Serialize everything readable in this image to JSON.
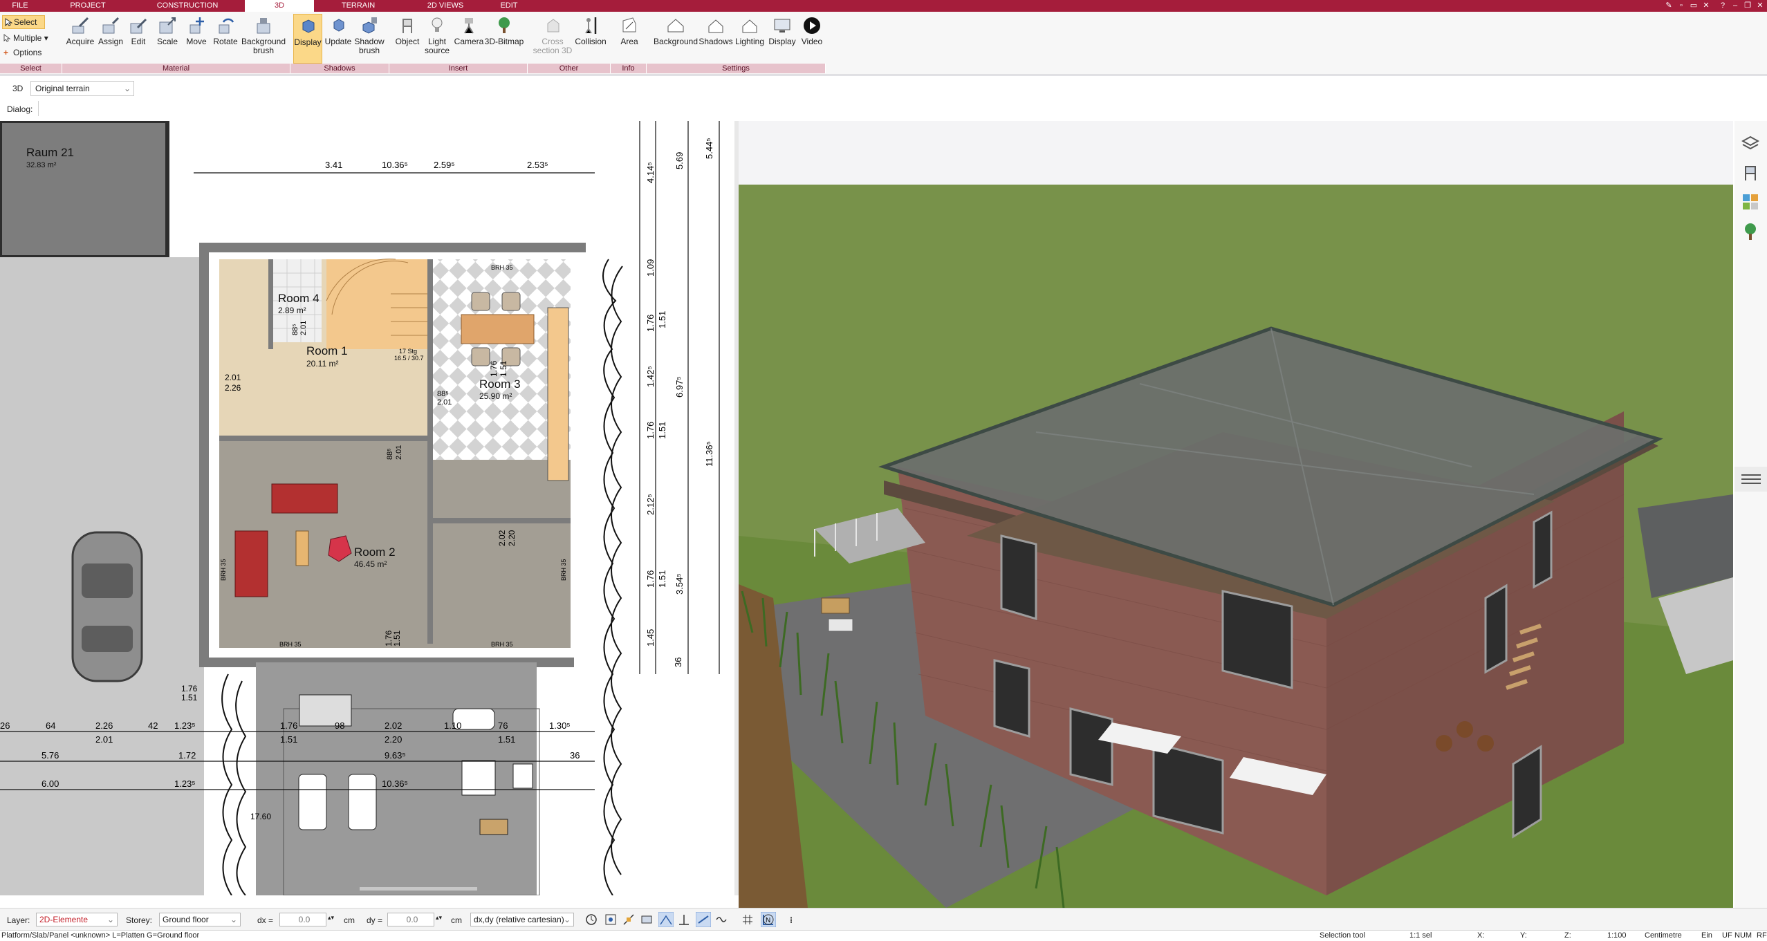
{
  "menu": {
    "tabs": [
      "FILE",
      "PROJECT",
      "CONSTRUCTION",
      "3D",
      "TERRAIN",
      "2D VIEWS",
      "EDIT"
    ],
    "active_tab": "3D"
  },
  "ribbon": {
    "select_group": {
      "select_label": "Select",
      "multiple_label": "Multiple",
      "options_label": "Options",
      "group_label": "Select"
    },
    "material_group": {
      "items": [
        "Acquire",
        "Assign",
        "Edit",
        "Scale",
        "Move",
        "Rotate",
        "Background brush"
      ],
      "group_label": "Material"
    },
    "shadows_group": {
      "items": [
        "Display",
        "Update",
        "Shadow brush"
      ],
      "group_label": "Shadows"
    },
    "insert_group": {
      "items": [
        "Object",
        "Light source",
        "Camera",
        "3D-Bitmap"
      ],
      "group_label": "Insert"
    },
    "other_group": {
      "items": [
        "Cross section 3D",
        "Collision"
      ],
      "group_label": "Other"
    },
    "info_group": {
      "items": [
        "Area"
      ],
      "group_label": "Info"
    },
    "settings_group": {
      "items": [
        "Background",
        "Shadows",
        "Lighting",
        "Display",
        "Video"
      ],
      "group_label": "Settings"
    }
  },
  "viewbar": {
    "view_label": "3D",
    "terrain_select": "Original terrain"
  },
  "dialogbar": {
    "label": "Dialog:"
  },
  "plan": {
    "rooms": [
      {
        "name": "Raum 21",
        "area": "32.83 m²"
      },
      {
        "name": "Room 4",
        "area": "2.89 m²"
      },
      {
        "name": "Room 1",
        "area": "20.11 m²"
      },
      {
        "name": "Room 3",
        "area": "25.90 m²"
      },
      {
        "name": "Room 2",
        "area": "46.45 m²"
      }
    ],
    "top_dims": [
      "3.41",
      "10.36⁵",
      "2.59⁵",
      "2.53⁵"
    ],
    "right_dims": [
      "5.69",
      "5.44⁵",
      "4.14⁵",
      "1.09",
      "1.76",
      "1.51",
      "1.42⁵",
      "6.97⁵",
      "1.76",
      "1.51",
      "11.36⁵",
      "2.12⁵",
      "1.76",
      "1.51",
      "3.54⁵",
      "1.45",
      "36"
    ],
    "bottom_dims_row1": [
      "26",
      "64",
      "2.26",
      "42",
      "1.23⁵",
      "1.76",
      "98",
      "2.02",
      "1.10",
      "76",
      "1.30⁵"
    ],
    "bottom_dims_row1b": [
      "2.01",
      "1.51",
      "2.20",
      "1.51"
    ],
    "bottom_dims_row2": [
      "5.76",
      "1.72",
      "9.63⁵",
      "36"
    ],
    "bottom_dims_row3": [
      "6.00",
      "1.23⁵",
      "10.36⁵"
    ],
    "misc_labels": [
      "BRH 35",
      "BRH 35",
      "BRH 35",
      "BRH 35",
      "BRH 35",
      "17 Stg",
      "16.5 / 30.7",
      "2.01",
      "2.26",
      "88⁵",
      "2.01",
      "88⁵",
      "2.01",
      "88⁵",
      "2.01",
      "1.76",
      "1.51",
      "1.76",
      "1.51",
      "2.02",
      "2.20",
      "1.76",
      "1.51",
      "17.60"
    ]
  },
  "bottombar": {
    "layer_label": "Layer:",
    "layer_value": "2D-Elemente",
    "storey_label": "Storey:",
    "storey_value": "Ground floor",
    "dx_label": "dx =",
    "dx_value": "0.0",
    "dx_unit": "cm",
    "dy_label": "dy =",
    "dy_value": "0.0",
    "dy_unit": "cm",
    "coord_mode": "dx,dy (relative cartesian)"
  },
  "statusbar": {
    "info": "Platform/Slab/Panel <unknown> L=Platten G=Ground floor",
    "tool": "Selection tool",
    "selection": "1:1 sel",
    "x_label": "X:",
    "y_label": "Y:",
    "z_label": "Z:",
    "scale": "1:100",
    "unit": "Centimetre",
    "ein": "Ein",
    "uf": "UF",
    "num": "NUM",
    "rf": "RF"
  },
  "colors": {
    "brand": "#a51d3b",
    "group_bar": "#e7c3cc",
    "active_item": "#fbd888",
    "grass": "#6f8b3a",
    "roof": "#666a68",
    "brick": "#8a5a52"
  }
}
